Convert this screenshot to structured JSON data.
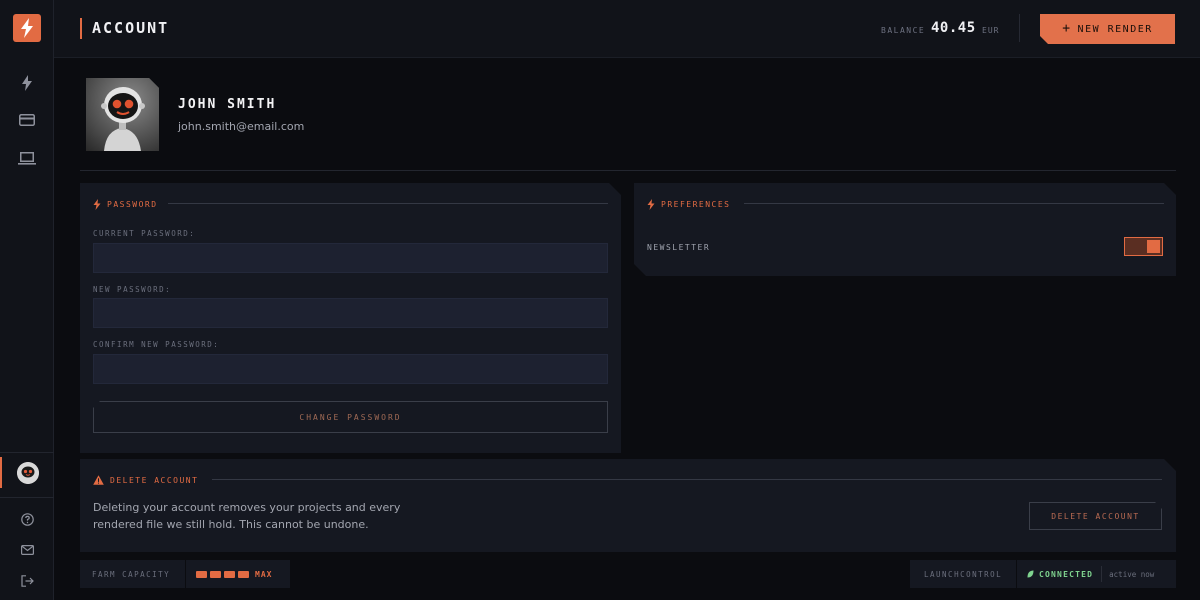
{
  "topbar": {
    "title": "ACCOUNT",
    "balance_label": "BALANCE",
    "balance_value": "40.45",
    "balance_currency": "EUR",
    "new_render_label": "NEW RENDER"
  },
  "profile": {
    "name": "JOHN SMITH",
    "email": "john.smith@email.com"
  },
  "password": {
    "heading": "PASSWORD",
    "current_label": "CURRENT PASSWORD:",
    "new_label": "NEW PASSWORD:",
    "confirm_label": "CONFIRM NEW PASSWORD:",
    "current_value": "",
    "new_value": "",
    "confirm_value": "",
    "submit_label": "CHANGE PASSWORD"
  },
  "preferences": {
    "heading": "PREFERENCES",
    "newsletter_label": "NEWSLETTER",
    "newsletter_on": true
  },
  "delete": {
    "heading": "DELETE ACCOUNT",
    "description": "Deleting your account removes your projects and every rendered file we still hold. This cannot be undone.",
    "button_label": "DELETE ACCOUNT"
  },
  "footer": {
    "farm_capacity_label": "FARM CAPACITY",
    "farm_capacity_value": "MAX",
    "farm_capacity_level": 4,
    "launchcontrol_label": "LAUNCHCONTROL",
    "status_label": "CONNECTED",
    "status_time": "active now"
  },
  "colors": {
    "accent": "#e26b43",
    "status_green": "#7fd38f"
  }
}
